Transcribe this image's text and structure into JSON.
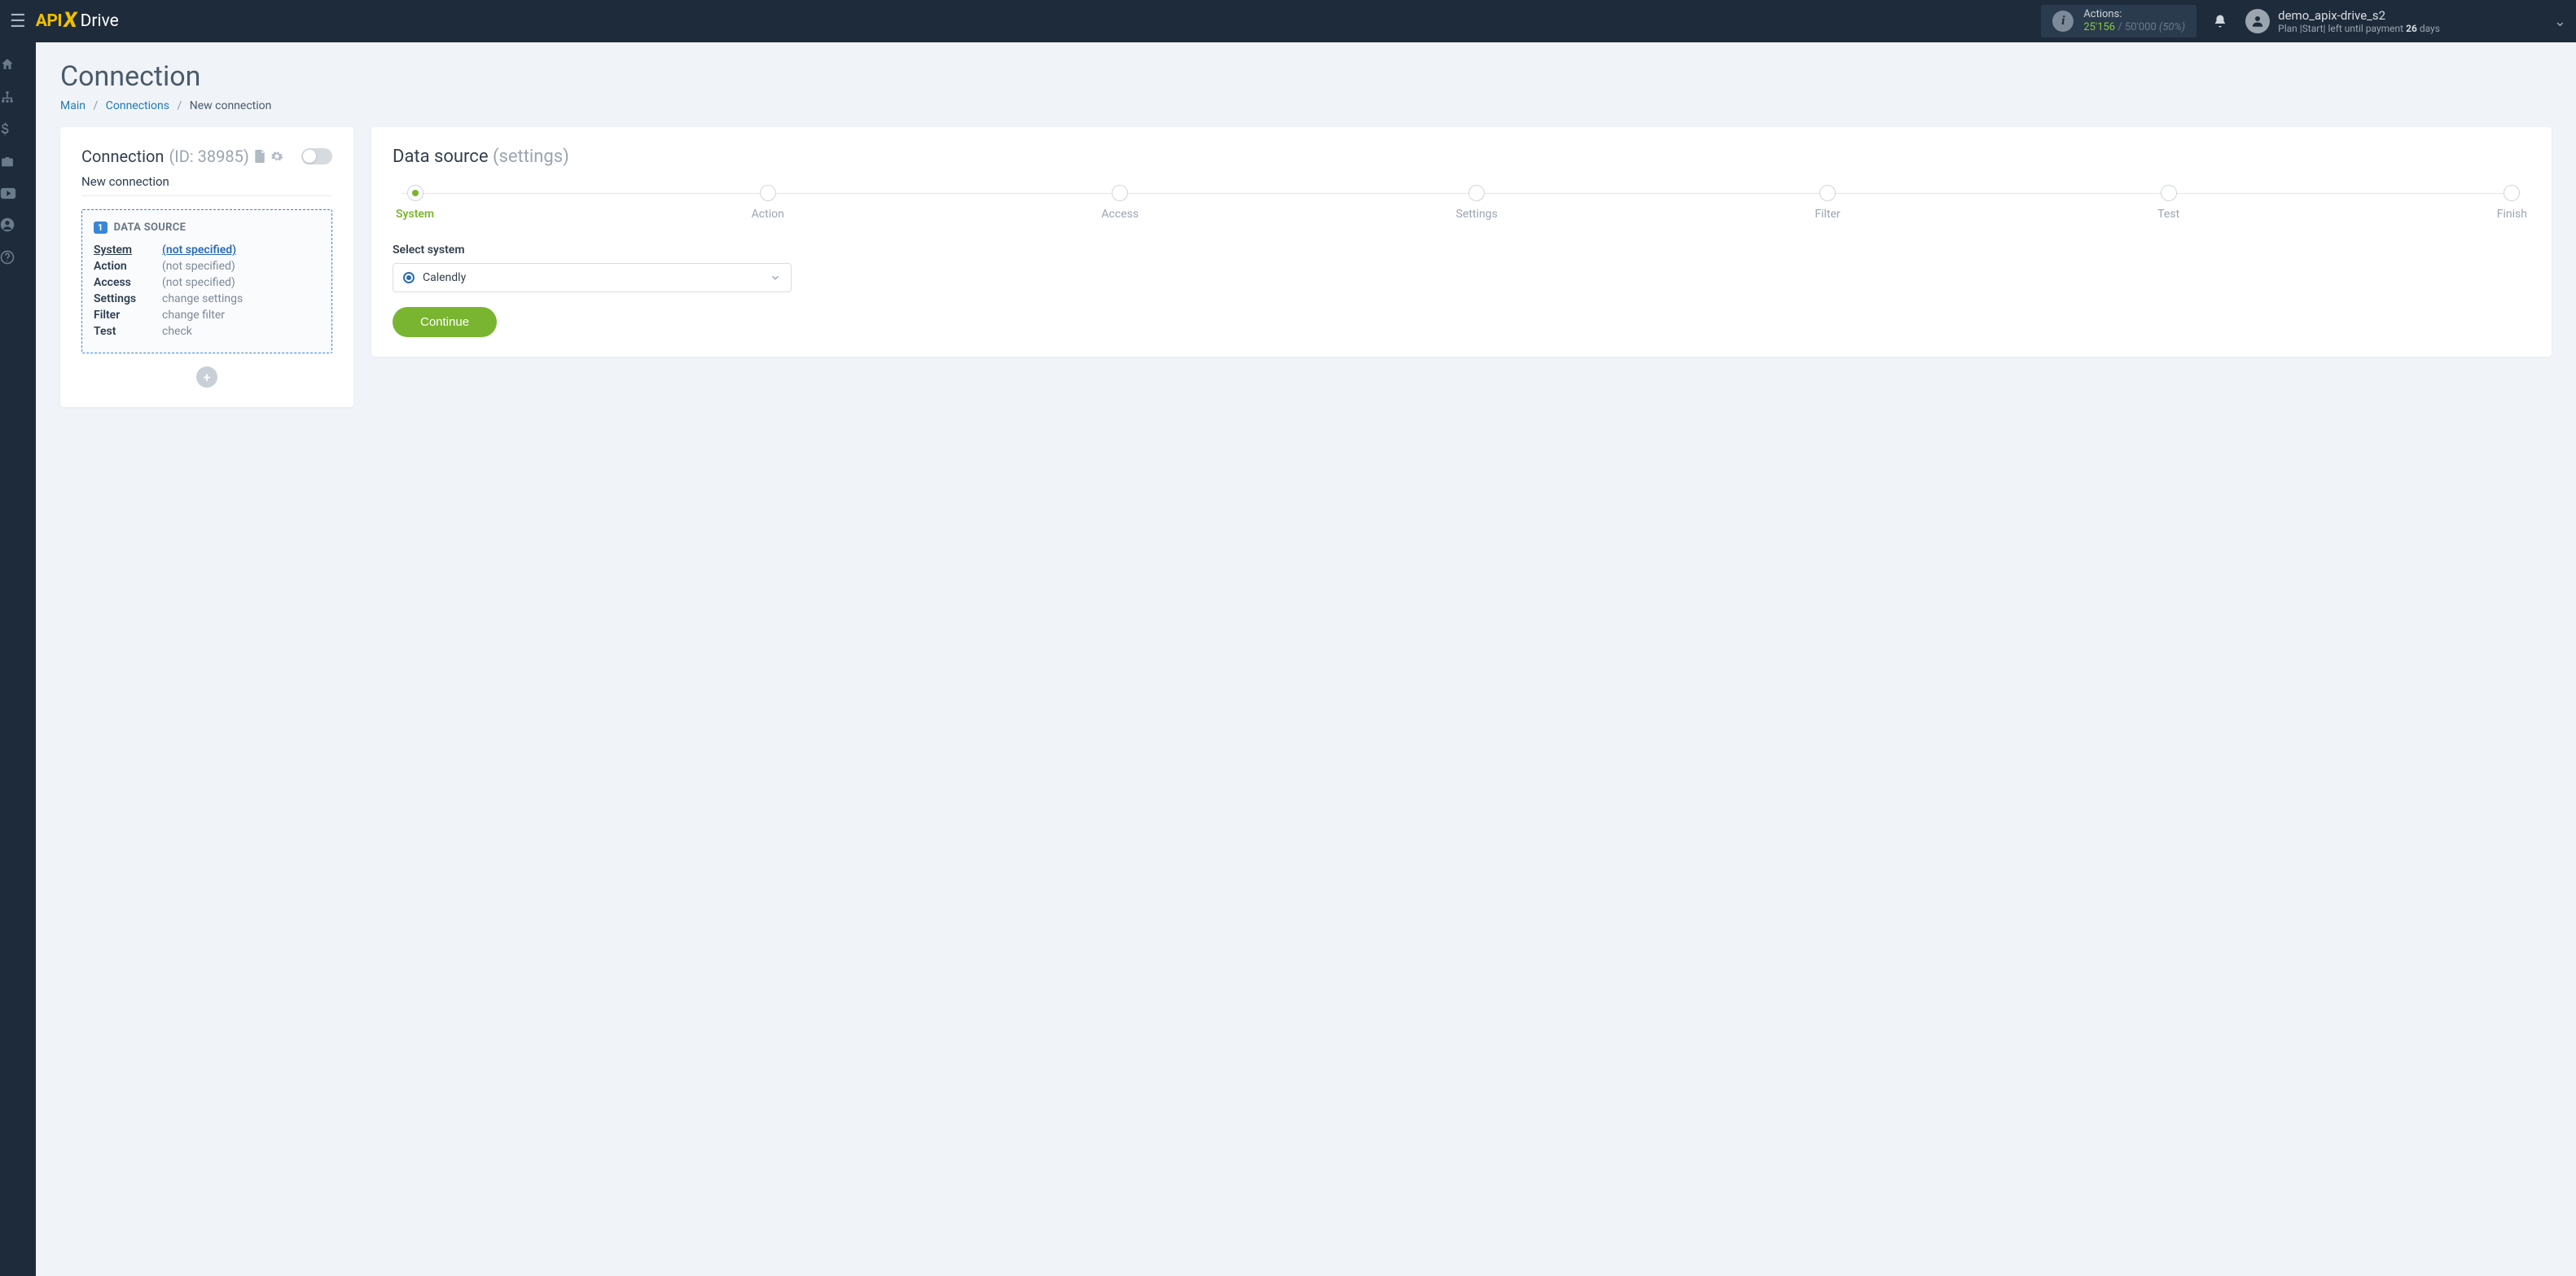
{
  "header": {
    "actions_label": "Actions:",
    "actions_used": "25'156",
    "actions_total": "/ 50'000",
    "actions_pct": "(50%)",
    "user_name": "demo_apix-drive_s2",
    "plan_prefix": "Plan |Start| left until payment ",
    "plan_days": "26",
    "plan_suffix": " days"
  },
  "page": {
    "title": "Connection",
    "crumb_main": "Main",
    "crumb_connections": "Connections",
    "crumb_current": "New connection"
  },
  "left": {
    "heading": "Connection",
    "id_label": "(ID: 38985)",
    "name": "New connection",
    "source_heading": "DATA SOURCE",
    "badge": "1",
    "rows": {
      "system_k": "System",
      "system_v": "(not specified)",
      "action_k": "Action",
      "action_v": "(not specified)",
      "access_k": "Access",
      "access_v": "(not specified)",
      "settings_k": "Settings",
      "settings_v": "change settings",
      "filter_k": "Filter",
      "filter_v": "change filter",
      "test_k": "Test",
      "test_v": "check"
    }
  },
  "right": {
    "title": "Data source",
    "title_sub": "(settings)",
    "steps": {
      "s1": "System",
      "s2": "Action",
      "s3": "Access",
      "s4": "Settings",
      "s5": "Filter",
      "s6": "Test",
      "s7": "Finish"
    },
    "field_label": "Select system",
    "selected": "Calendly",
    "continue": "Continue"
  }
}
